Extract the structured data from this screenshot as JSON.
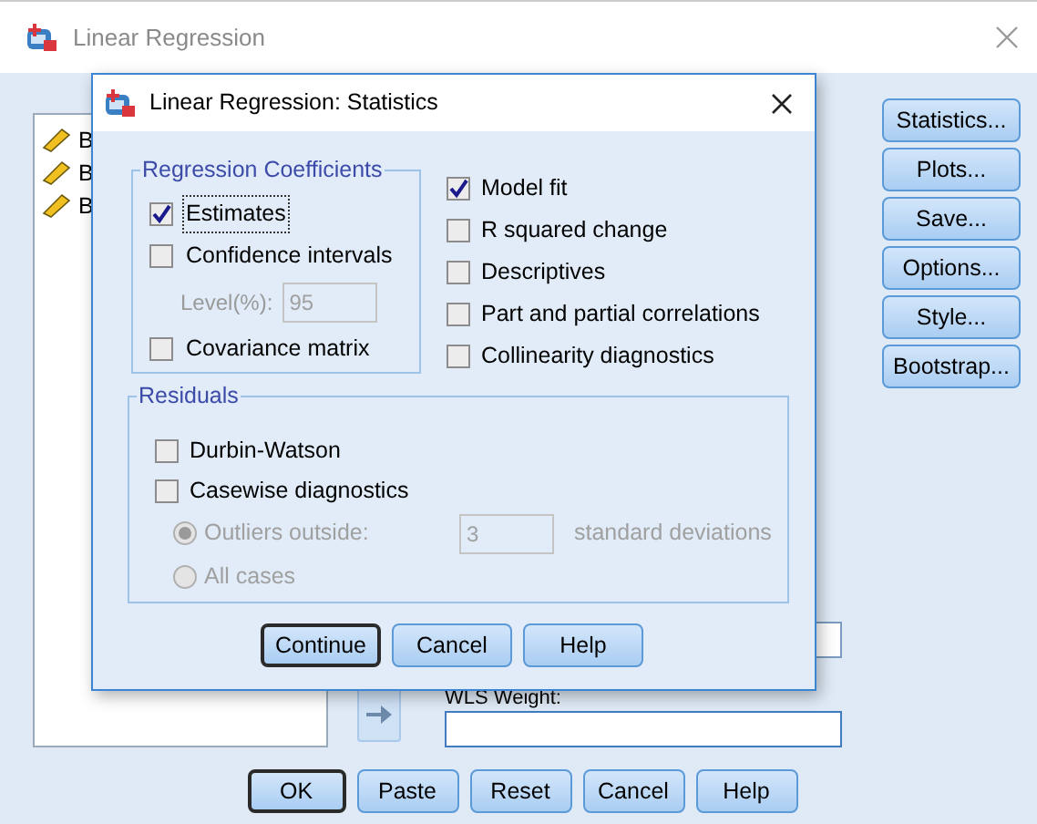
{
  "window": {
    "title": "Linear Regression"
  },
  "variables": [
    {
      "label": "B"
    },
    {
      "label": "B"
    },
    {
      "label": "B"
    }
  ],
  "side_buttons": [
    {
      "label": "Statistics..."
    },
    {
      "label": "Plots..."
    },
    {
      "label": "Save..."
    },
    {
      "label": "Options..."
    },
    {
      "label": "Style..."
    },
    {
      "label": "Bootstrap..."
    }
  ],
  "weight": {
    "label": "WLS Weight:"
  },
  "buttons": [
    {
      "label": "OK",
      "default": true
    },
    {
      "label": "Paste",
      "default": false
    },
    {
      "label": "Reset",
      "default": false
    },
    {
      "label": "Cancel",
      "default": false
    },
    {
      "label": "Help",
      "default": false
    }
  ],
  "dialog": {
    "title": "Linear Regression: Statistics",
    "coefficients": {
      "title": "Regression Coefficients",
      "items": [
        {
          "kind": "checkbox",
          "label": "Estimates",
          "checked": true,
          "focused": true
        },
        {
          "kind": "checkbox",
          "label": "Confidence intervals",
          "checked": false,
          "focused": false
        },
        {
          "kind": "field",
          "label": "Level(%):",
          "value": "95",
          "disabled": true
        },
        {
          "kind": "checkbox",
          "label": "Covariance matrix",
          "checked": false,
          "focused": false
        }
      ]
    },
    "model_items": [
      {
        "label": "Model fit",
        "checked": true
      },
      {
        "label": "R squared change",
        "checked": false
      },
      {
        "label": "Descriptives",
        "checked": false
      },
      {
        "label": "Part and partial correlations",
        "checked": false
      },
      {
        "label": "Collinearity diagnostics",
        "checked": false
      }
    ],
    "residuals": {
      "title": "Residuals",
      "items": [
        {
          "kind": "checkbox",
          "label": "Durbin-Watson",
          "checked": false
        },
        {
          "kind": "checkbox",
          "label": "Casewise diagnostics",
          "checked": false
        },
        {
          "kind": "radio",
          "label": "Outliers outside:",
          "selected": true,
          "disabled": true,
          "value": "3",
          "suffix": "standard deviations"
        },
        {
          "kind": "radio",
          "label": "All cases",
          "selected": false,
          "disabled": true
        }
      ]
    },
    "buttons": [
      {
        "label": "Continue",
        "default": true
      },
      {
        "label": "Cancel",
        "default": false
      },
      {
        "label": "Help",
        "default": false
      }
    ]
  }
}
